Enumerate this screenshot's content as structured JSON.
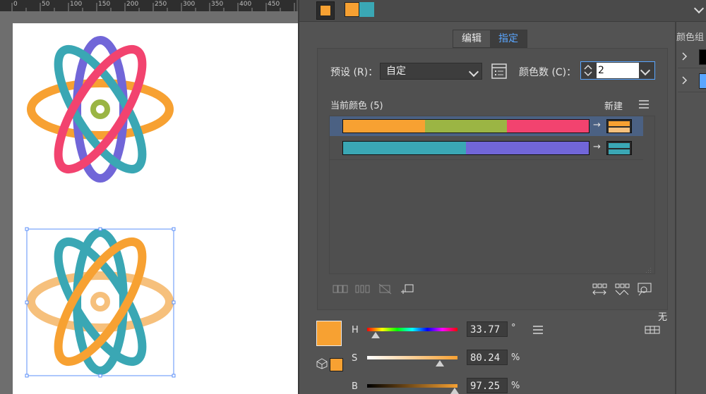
{
  "ruler": {
    "labels": [
      "0",
      "50",
      "100",
      "150",
      "200",
      "250",
      "300",
      "350",
      "400",
      "450"
    ]
  },
  "panel": {
    "tabs": [
      {
        "label": "编辑",
        "active": false
      },
      {
        "label": "指定",
        "active": true
      }
    ],
    "preset_label": "预设 (R)：",
    "preset_value": "自定",
    "color_count_label": "颜色数 (C)：",
    "color_count_value": "2",
    "current_colors_label": "当前颜色 (5)",
    "new_label": "新建",
    "none_label": "无",
    "groups_title": "颜色组",
    "rows": [
      {
        "colors": [
          "#f7a132",
          "#9bb544",
          "#f2436f"
        ],
        "new_colors": [
          "#f7a132",
          "#f6c07c"
        ]
      },
      {
        "colors": [
          "#3aa7b4",
          "#7166d8"
        ],
        "new_colors": [
          "#3aa7b4",
          "#3aa7b4"
        ]
      }
    ],
    "sliders": [
      {
        "label": "H",
        "value": "33.77",
        "unit": "°",
        "position": 0.0938
      },
      {
        "label": "S",
        "value": "80.24",
        "unit": "%",
        "position": 0.8024
      },
      {
        "label": "B",
        "value": "97.25",
        "unit": "%",
        "position": 0.9725
      }
    ],
    "fill_color": "#f7a132",
    "accent": "#5aa6ff",
    "swatch_pair": [
      "#f7a132",
      "#3aa7b4"
    ]
  },
  "icons": [
    "expand-icon",
    "menu-icon",
    "list-icon",
    "chevron-down-icon",
    "spinner-icon",
    "arrow-right-icon",
    "merge-icon",
    "separate-icon",
    "exclude-icon",
    "new-row-icon",
    "randomize-order-icon",
    "randomize-saturation-icon",
    "find-icon",
    "color-mode-icon",
    "cube-icon"
  ]
}
